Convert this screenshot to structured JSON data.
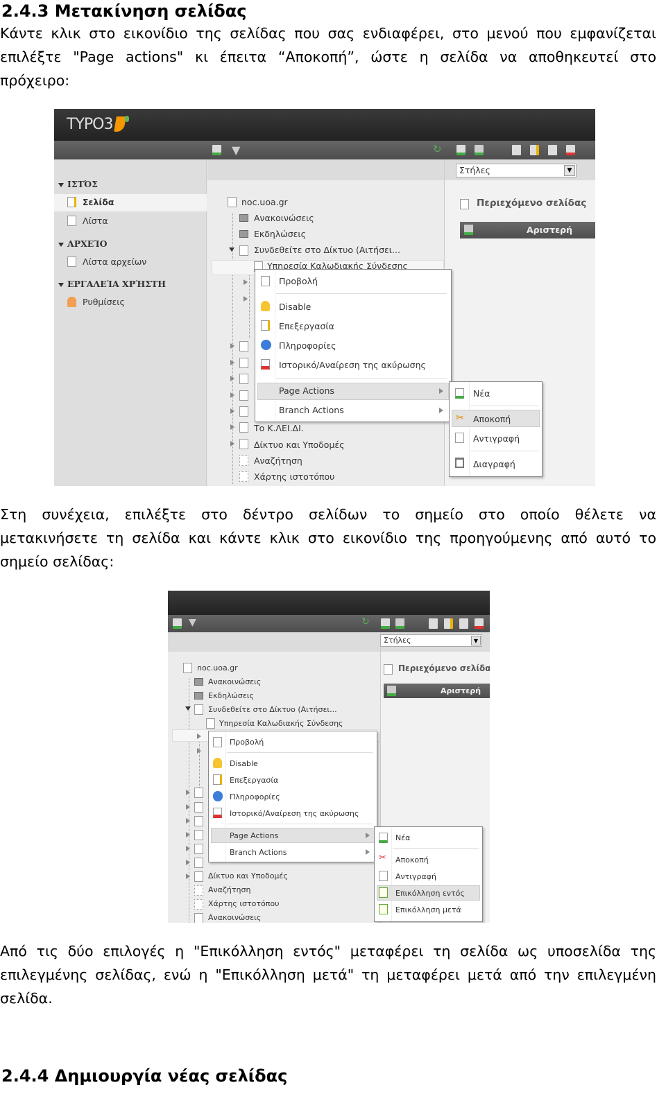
{
  "section_1": {
    "heading": "2.4.3 Μετακίνηση σελίδας",
    "lines": [
      "Κάντε κλικ στο εικονίδιο της σελίδας που σας ενδιαφέρει, στο μενού που εμφανίζεται",
      "επιλέξτε \"Page actions\" κι έπειτα “Αποκοπή”, ώστε η σελίδα να αποθηκευτεί στο",
      "πρόχειρο:"
    ]
  },
  "screenshot_1": {
    "logo": "TYPO3",
    "sidebar": {
      "groups": [
        {
          "title": "ΙΣΤΌΣ",
          "items": [
            "Σελίδα",
            "Λίστα"
          ]
        },
        {
          "title": "ΑΡΧΕΊΟ",
          "items": [
            "Λίστα αρχείων"
          ]
        },
        {
          "title": "ΕΡΓΑΛΕΊΑ ΧΡΉΣΤΗ",
          "items": [
            "Ρυθμίσεις"
          ]
        }
      ]
    },
    "tree": [
      "noc.uoa.gr",
      "Ανακοινώσεις",
      "Εκδηλώσεις",
      "Συνδεθείτε στο Δίκτυο (Αιτήσει...",
      "Υπηρεσία Καλωδιακής Σύνδεσης",
      "Το Κ.ΛΕΙ.ΔΙ.",
      "Δίκτυο και Υποδομές",
      "Αναζήτηση",
      "Χάρτης ιστοτόπου"
    ],
    "columns_select": "Στήλες",
    "content_title": "Περιεχόμενο σελίδας",
    "column_bar": "Αριστερή",
    "context_menu": [
      "Προβολή",
      "Disable",
      "Επεξεργασία",
      "Πληροφορίες",
      "Ιστορικό/Αναίρεση της ακύρωσης",
      "Page Actions",
      "Branch Actions"
    ],
    "submenu": [
      "Νέα",
      "Αποκοπή",
      "Αντιγραφή",
      "Διαγραφή"
    ],
    "highlighted_submenu_item": "Αποκοπή"
  },
  "section_2": {
    "lines": [
      "Στη συνέχεια, επιλέξτε στο δέντρο σελίδων το σημείο στο οποίο θέλετε να",
      "μετακινήσετε τη σελίδα και κάντε κλικ στο εικονίδιο της προηγούμενης από αυτό το",
      "σημείο σελίδας:"
    ]
  },
  "screenshot_2": {
    "tree": [
      "noc.uoa.gr",
      "Ανακοινώσεις",
      "Εκδηλώσεις",
      "Συνδεθείτε στο Δίκτυο (Αιτήσει...",
      "Υπηρεσία Καλωδιακής Σύνδεσης",
      "Δίκτυο και Υποδομές",
      "Αναζήτηση",
      "Χάρτης ιστοτόπου",
      "Ανακοινώσεις"
    ],
    "columns_select": "Στήλες",
    "content_title": "Περιεχόμενο σελίδας",
    "column_bar": "Αριστερή",
    "context_menu": [
      "Προβολή",
      "Disable",
      "Επεξεργασία",
      "Πληροφορίες",
      "Ιστορικό/Αναίρεση της ακύρωσης",
      "Page Actions",
      "Branch Actions"
    ],
    "submenu": [
      "Νέα",
      "Αποκοπή",
      "Αντιγραφή",
      "Επικόλληση εντός",
      "Επικόλληση μετά"
    ],
    "highlighted_submenu_item": "Επικόλληση εντός"
  },
  "section_3": {
    "lines": [
      "Από τις δύο επιλογές η \"Επικόλληση εντός\" μεταφέρει τη σελίδα ως υποσελίδα της",
      "επιλεγμένης σελίδας, ενώ η \"Επικόλληση μετά\" τη μεταφέρει μετά από την επιλεγμένη",
      "σελίδα."
    ]
  },
  "section_4": {
    "heading": "2.4.4 Δημιουργία νέας σελίδας"
  },
  "colors": {
    "header_dark": "#2b2b2b",
    "toolbar": "#585858",
    "panel": "#e9e9e9",
    "typo3_orange": "#f49700",
    "highlight": "#e2e2e2"
  }
}
